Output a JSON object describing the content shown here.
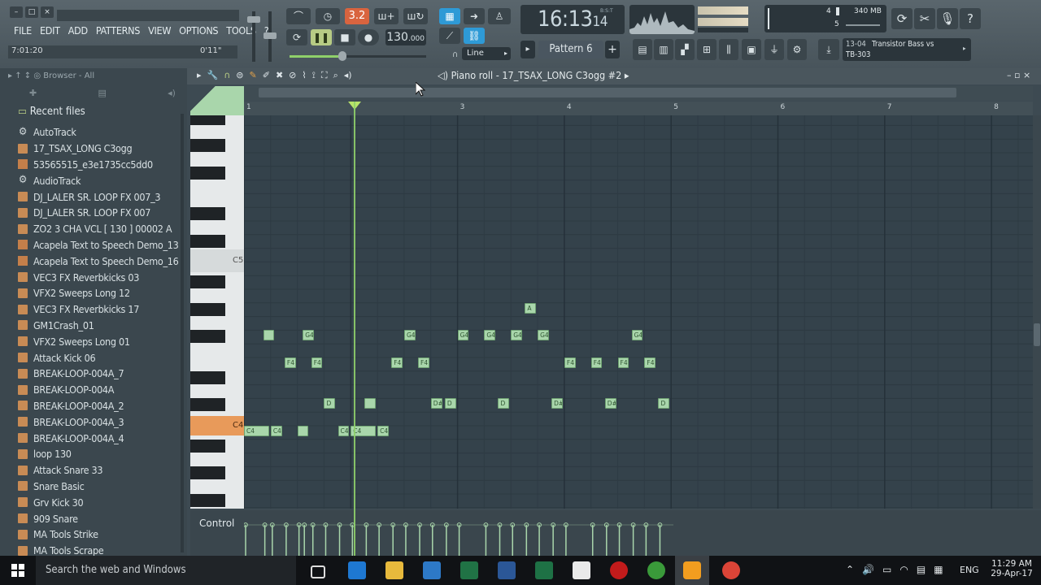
{
  "menu": [
    "FILE",
    "EDIT",
    "ADD",
    "PATTERNS",
    "VIEW",
    "OPTIONS",
    "TOOLS",
    "?"
  ],
  "song_position": "7:01:20",
  "hint_time": "0'11\"",
  "tempo": "130",
  "tempo_fraction": ".000",
  "clock": {
    "main": "16:13",
    "small": "14",
    "label": "B:S:T"
  },
  "snap_mode": "Line",
  "pattern": "Pattern 6",
  "memory": "340 MB",
  "cpu_numbers": [
    "4",
    "5"
  ],
  "channel": {
    "index": "13-04",
    "name": "Transistor Bass vs",
    "name2": "TB-303"
  },
  "top_badge": "3.2",
  "browser": {
    "title": "Browser - All",
    "section": "Recent files"
  },
  "files": [
    {
      "name": "AutoTrack",
      "icon": "gear"
    },
    {
      "name": "17_TSAX_LONG C3ogg",
      "icon": "file"
    },
    {
      "name": "53565515_e3e1735cc5dd0",
      "icon": "wave"
    },
    {
      "name": "AudioTrack",
      "icon": "gear"
    },
    {
      "name": "DJ_LALER SR. LOOP FX 007_3",
      "icon": "file"
    },
    {
      "name": "DJ_LALER SR. LOOP FX 007",
      "icon": "file"
    },
    {
      "name": "ZO2 3 CHA VCL [ 130 ] 00002 A",
      "icon": "file"
    },
    {
      "name": "Acapela Text to Speech Demo_13",
      "icon": "wave"
    },
    {
      "name": "Acapela Text to Speech Demo_16",
      "icon": "wave"
    },
    {
      "name": "VEC3 FX Reverbkicks 03",
      "icon": "file"
    },
    {
      "name": "VFX2 Sweeps Long 12",
      "icon": "file"
    },
    {
      "name": "VEC3 FX Reverbkicks 17",
      "icon": "file"
    },
    {
      "name": "GM1Crash_01",
      "icon": "file"
    },
    {
      "name": "VFX2 Sweeps Long 01",
      "icon": "file"
    },
    {
      "name": "Attack Kick 06",
      "icon": "file"
    },
    {
      "name": "BREAK-LOOP-004A_7",
      "icon": "file"
    },
    {
      "name": "BREAK-LOOP-004A",
      "icon": "file"
    },
    {
      "name": "BREAK-LOOP-004A_2",
      "icon": "file"
    },
    {
      "name": "BREAK-LOOP-004A_3",
      "icon": "file"
    },
    {
      "name": "BREAK-LOOP-004A_4",
      "icon": "file"
    },
    {
      "name": "loop 130",
      "icon": "file"
    },
    {
      "name": "Attack Snare 33",
      "icon": "file"
    },
    {
      "name": "Snare Basic",
      "icon": "file"
    },
    {
      "name": "Grv Kick 30",
      "icon": "file"
    },
    {
      "name": "909 Snare",
      "icon": "file"
    },
    {
      "name": "MA Tools Strike",
      "icon": "file"
    },
    {
      "name": "MA Tools Scrape",
      "icon": "file"
    }
  ],
  "piano_roll": {
    "title": "Piano roll - 17_TSAX_LONG C3ogg #2",
    "ruler_bars": [
      "1",
      "3",
      "4",
      "5",
      "6",
      "7",
      "8"
    ],
    "key_labels": {
      "c5": "C5",
      "c4": "C4"
    },
    "control_label": "Control",
    "notes": [
      {
        "start": 1.18,
        "len": 0.12,
        "row": "G4",
        "label": ""
      },
      {
        "start": 1.55,
        "len": 0.12,
        "row": "G4",
        "label": "G4"
      },
      {
        "start": 2.5,
        "len": 0.12,
        "row": "G4",
        "label": "G4"
      },
      {
        "start": 3.0,
        "len": 0.12,
        "row": "G4",
        "label": "G4"
      },
      {
        "start": 3.25,
        "len": 0.12,
        "row": "G4",
        "label": "G4"
      },
      {
        "start": 3.5,
        "len": 0.12,
        "row": "G4",
        "label": "G4"
      },
      {
        "start": 3.75,
        "len": 0.12,
        "row": "G4",
        "label": "G4"
      },
      {
        "start": 4.63,
        "len": 0.12,
        "row": "G4",
        "label": "G4"
      },
      {
        "start": 1.38,
        "len": 0.12,
        "row": "F4",
        "label": "F4"
      },
      {
        "start": 1.63,
        "len": 0.12,
        "row": "F4",
        "label": "F4"
      },
      {
        "start": 2.38,
        "len": 0.12,
        "row": "F4",
        "label": "F4"
      },
      {
        "start": 2.63,
        "len": 0.12,
        "row": "F4",
        "label": "F4"
      },
      {
        "start": 4.0,
        "len": 0.12,
        "row": "F4",
        "label": "F4"
      },
      {
        "start": 4.25,
        "len": 0.12,
        "row": "F4",
        "label": "F4"
      },
      {
        "start": 4.5,
        "len": 0.12,
        "row": "F4",
        "label": "F4"
      },
      {
        "start": 4.75,
        "len": 0.12,
        "row": "F4",
        "label": "F4"
      },
      {
        "start": 1.75,
        "len": 0.12,
        "row": "D4",
        "label": "D"
      },
      {
        "start": 2.13,
        "len": 0.12,
        "row": "D4",
        "label": ""
      },
      {
        "start": 2.75,
        "len": 0.12,
        "row": "D4",
        "label": "D#4"
      },
      {
        "start": 2.88,
        "len": 0.12,
        "row": "D4",
        "label": "D"
      },
      {
        "start": 3.38,
        "len": 0.12,
        "row": "D4",
        "label": "D"
      },
      {
        "start": 3.88,
        "len": 0.12,
        "row": "D4",
        "label": "D#4"
      },
      {
        "start": 4.38,
        "len": 0.12,
        "row": "D4",
        "label": "D#4"
      },
      {
        "start": 4.88,
        "len": 0.12,
        "row": "D4",
        "label": "D"
      },
      {
        "start": 1.0,
        "len": 0.25,
        "row": "C4",
        "label": "C4"
      },
      {
        "start": 1.25,
        "len": 0.12,
        "row": "C4",
        "label": "C4"
      },
      {
        "start": 1.5,
        "len": 0.12,
        "row": "C4",
        "label": ""
      },
      {
        "start": 1.88,
        "len": 0.12,
        "row": "C4",
        "label": "C4"
      },
      {
        "start": 2.0,
        "len": 0.25,
        "row": "C4",
        "label": "C4"
      },
      {
        "start": 2.25,
        "len": 0.12,
        "row": "C4",
        "label": "C4"
      },
      {
        "start": 3.63,
        "len": 0.12,
        "row": "A4",
        "label": "A"
      }
    ]
  },
  "taskbar": {
    "search": "Search the web and Windows",
    "lang": "ENG",
    "time": "11:29 AM",
    "date": "29-Apr-17"
  }
}
